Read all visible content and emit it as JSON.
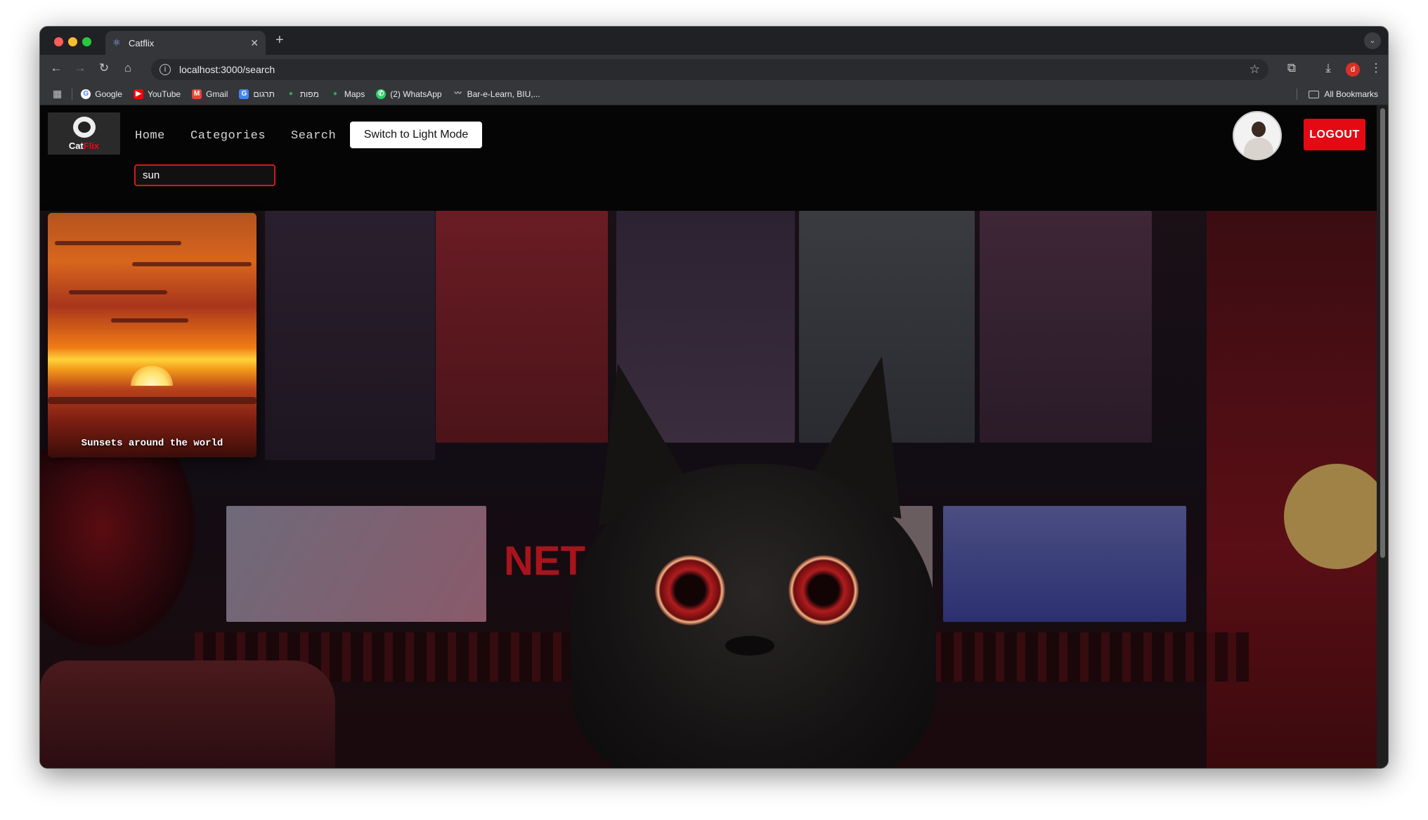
{
  "browser": {
    "tab_title": "Catflix",
    "url": "localhost:3000/search",
    "bookmarks": [
      {
        "label": "Google",
        "color": "#4285f4"
      },
      {
        "label": "YouTube",
        "color": "#ff0000"
      },
      {
        "label": "Gmail",
        "color": "#ea4335"
      },
      {
        "label": "תרגום",
        "color": "#4285f4"
      },
      {
        "label": "מפות",
        "color": "#34a853"
      },
      {
        "label": "Maps",
        "color": "#34a853"
      },
      {
        "label": "(2) WhatsApp",
        "color": "#25d366"
      },
      {
        "label": "Bar-e-Learn, BIU,...",
        "color": "#9aa0a6"
      }
    ],
    "all_bookmarks": "All Bookmarks",
    "profile_initial": "d"
  },
  "app": {
    "logo": {
      "cat": "Cat",
      "flix": "Flix"
    },
    "nav": {
      "home": "Home",
      "categories": "Categories",
      "search": "Search"
    },
    "mode_button": "Switch to Light Mode",
    "search_value": "sun",
    "logout": "LOGOUT",
    "results": [
      {
        "title": "Sunsets around the world"
      }
    ],
    "accent_color": "#e50914"
  }
}
